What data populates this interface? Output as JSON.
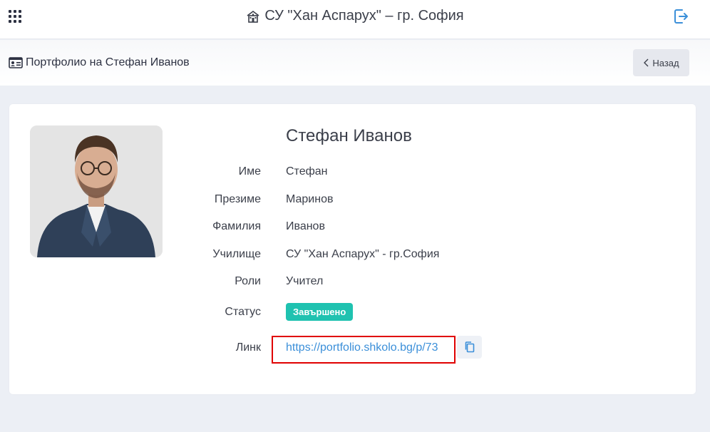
{
  "header": {
    "school_title": "СУ \"Хан Аспарух\" – гр. София",
    "icons": {
      "apps": "apps-grid-icon",
      "school": "school-building-icon",
      "logout": "logout-icon"
    }
  },
  "subheader": {
    "page_title": "Портфолио на Стефан Иванов",
    "back_label": "Назад",
    "icon": "id-card-icon"
  },
  "profile": {
    "full_name": "Стефан Иванов",
    "fields": [
      {
        "label": "Име",
        "value": "Стефан"
      },
      {
        "label": "Презиме",
        "value": "Маринов"
      },
      {
        "label": "Фамилия",
        "value": "Иванов"
      },
      {
        "label": "Училище",
        "value": "СУ \"Хан Аспарух\" - гр.София"
      },
      {
        "label": "Роли",
        "value": "Учител"
      }
    ],
    "status_label": "Статус",
    "status_value": "Завършено",
    "link_label": "Линк",
    "link_value": "https://portfolio.shkolo.bg/p/73"
  },
  "colors": {
    "accent": "#3b8fd9",
    "status": "#1fc2b0",
    "highlight": "#e00000",
    "background": "#eceff5"
  }
}
